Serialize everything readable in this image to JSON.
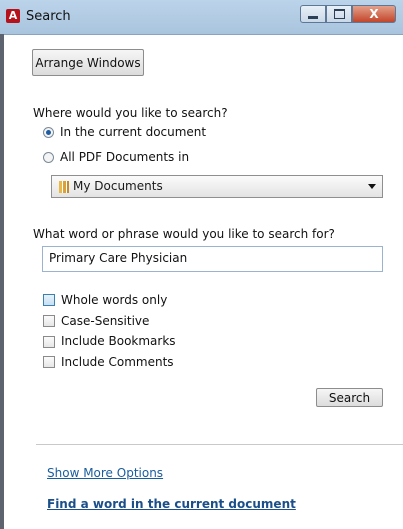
{
  "window": {
    "title": "Search",
    "app_icon_glyph": "A",
    "close_glyph": "X"
  },
  "toolbar": {
    "arrange_label": "Arrange Windows"
  },
  "where": {
    "question": "Where would you like to search?",
    "options": [
      {
        "label": "In the current document",
        "selected": true
      },
      {
        "label": "All PDF Documents in",
        "selected": false
      }
    ],
    "location_value": "My Documents"
  },
  "what": {
    "question": "What word or phrase would you like to search for?",
    "value": "Primary Care Physician"
  },
  "options": {
    "checkboxes": [
      {
        "label": "Whole words only",
        "checked": false
      },
      {
        "label": "Case-Sensitive",
        "checked": false
      },
      {
        "label": "Include Bookmarks",
        "checked": false
      },
      {
        "label": "Include Comments",
        "checked": false
      }
    ]
  },
  "actions": {
    "search_label": "Search"
  },
  "links": {
    "more_options": "Show More Options",
    "find_word": "Find a word in the current document"
  },
  "colors": {
    "link": "#1a5d9e",
    "titlebar": "#bcd4ea",
    "radio_selected": "#1f5ba0"
  },
  "icons": {
    "app": "adobe-reader-icon",
    "folder": "folder-icon",
    "dropdown": "chevron-down-icon"
  }
}
